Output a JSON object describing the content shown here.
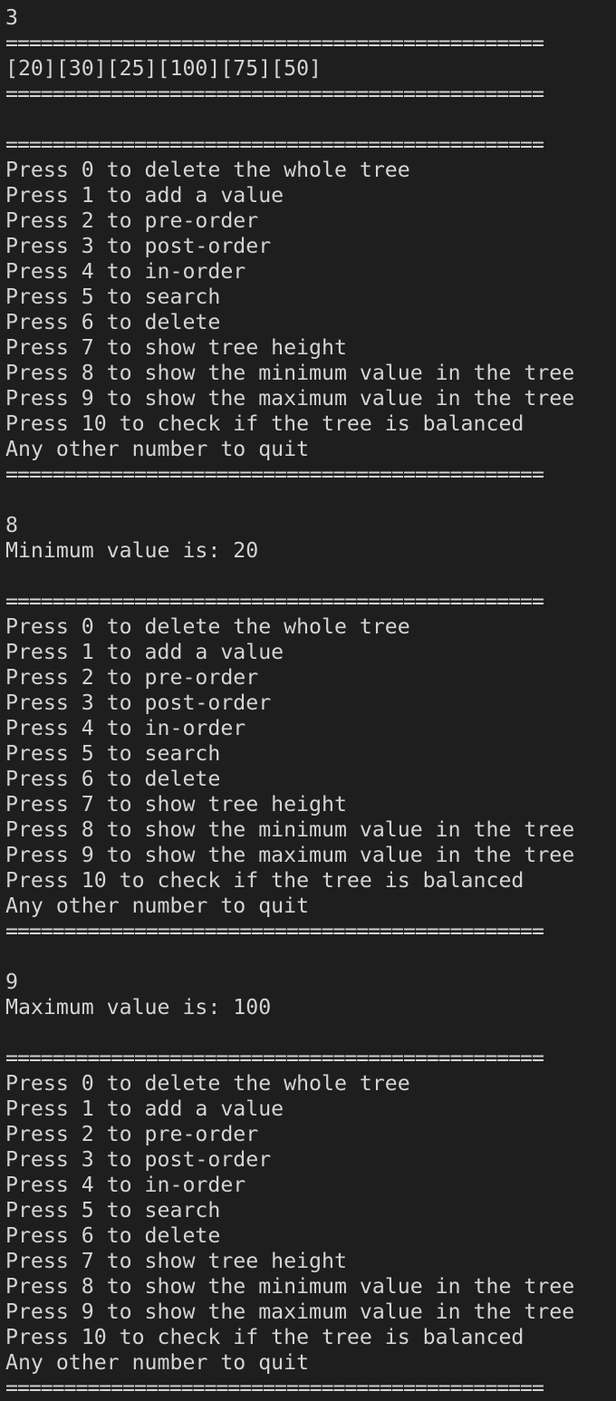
{
  "window": {
    "title": ""
  },
  "separator": "==============================================",
  "transcript": [
    {
      "kind": "input",
      "text": "3"
    },
    {
      "kind": "sep"
    },
    {
      "kind": "output",
      "text": "[20][30][25][100][75][50]"
    },
    {
      "kind": "sep"
    },
    {
      "kind": "blank"
    },
    {
      "kind": "sep"
    },
    {
      "kind": "menu",
      "block": 0
    },
    {
      "kind": "sep"
    },
    {
      "kind": "blank"
    },
    {
      "kind": "input",
      "text": "8"
    },
    {
      "kind": "output",
      "text": "Minimum value is: 20"
    },
    {
      "kind": "blank"
    },
    {
      "kind": "sep"
    },
    {
      "kind": "menu",
      "block": 1
    },
    {
      "kind": "sep"
    },
    {
      "kind": "blank"
    },
    {
      "kind": "input",
      "text": "9"
    },
    {
      "kind": "output",
      "text": "Maximum value is: 100"
    },
    {
      "kind": "blank"
    },
    {
      "kind": "sep"
    },
    {
      "kind": "menu",
      "block": 2
    },
    {
      "kind": "sep"
    }
  ],
  "menu_items": [
    "Press 0 to delete the whole tree",
    "Press 1 to add a value",
    "Press 2 to pre-order",
    "Press 3 to post-order",
    "Press 4 to in-order",
    "Press 5 to search",
    "Press 6 to delete",
    "Press 7 to show tree height",
    "Press 8 to show the minimum value in the tree",
    "Press 9 to show the maximum value in the tree",
    "Press 10 to check if the tree is balanced",
    "Any other number to quit"
  ],
  "colors": {
    "background": "#1e1e1e",
    "text": "#d4d4d4"
  }
}
